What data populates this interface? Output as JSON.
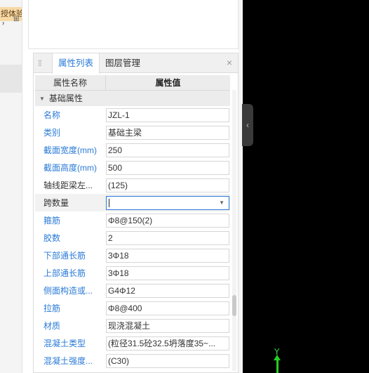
{
  "left_panel": {
    "experience_tag": "授体验",
    "tiny_glyph_a": "，",
    "tiny_glyph_b": "⊞"
  },
  "properties_panel": {
    "tabs": [
      {
        "label": "属性列表",
        "active": true
      },
      {
        "label": "图层管理",
        "active": false
      }
    ],
    "close_label": "×",
    "header": {
      "name_col": "属性名称",
      "value_col": "属性值"
    },
    "group_title": "基础属性",
    "rows": [
      {
        "name": "名称",
        "value": "JZL-1"
      },
      {
        "name": "类别",
        "value": "基础主梁"
      },
      {
        "name": "截面宽度(mm)",
        "value": "250"
      },
      {
        "name": "截面高度(mm)",
        "value": "500"
      },
      {
        "name": "轴线距梁左...",
        "value": "(125)"
      },
      {
        "name": "跨数量",
        "value": ""
      },
      {
        "name": "箍筋",
        "value": "Φ8@150(2)"
      },
      {
        "name": "胶数",
        "value": "2"
      },
      {
        "name": "下部通长筋",
        "value": "3Φ18"
      },
      {
        "name": "上部通长筋",
        "value": "3Φ18"
      },
      {
        "name": "侧面构造或...",
        "value": "G4Φ12"
      },
      {
        "name": "拉筋",
        "value": "Φ8@400"
      },
      {
        "name": "材质",
        "value": "现浇混凝土"
      },
      {
        "name": "混凝土类型",
        "value": "(粒径31.5砼32.5坍落度35~..."
      },
      {
        "name": "混凝土强度...",
        "value": "(C30)"
      }
    ]
  },
  "canvas": {
    "axis_label": "Y",
    "axis_color": "#22d022",
    "background": "#000000"
  },
  "colors": {
    "accent": "#2a7ad6",
    "tag_bg": "#f7d9a6"
  }
}
